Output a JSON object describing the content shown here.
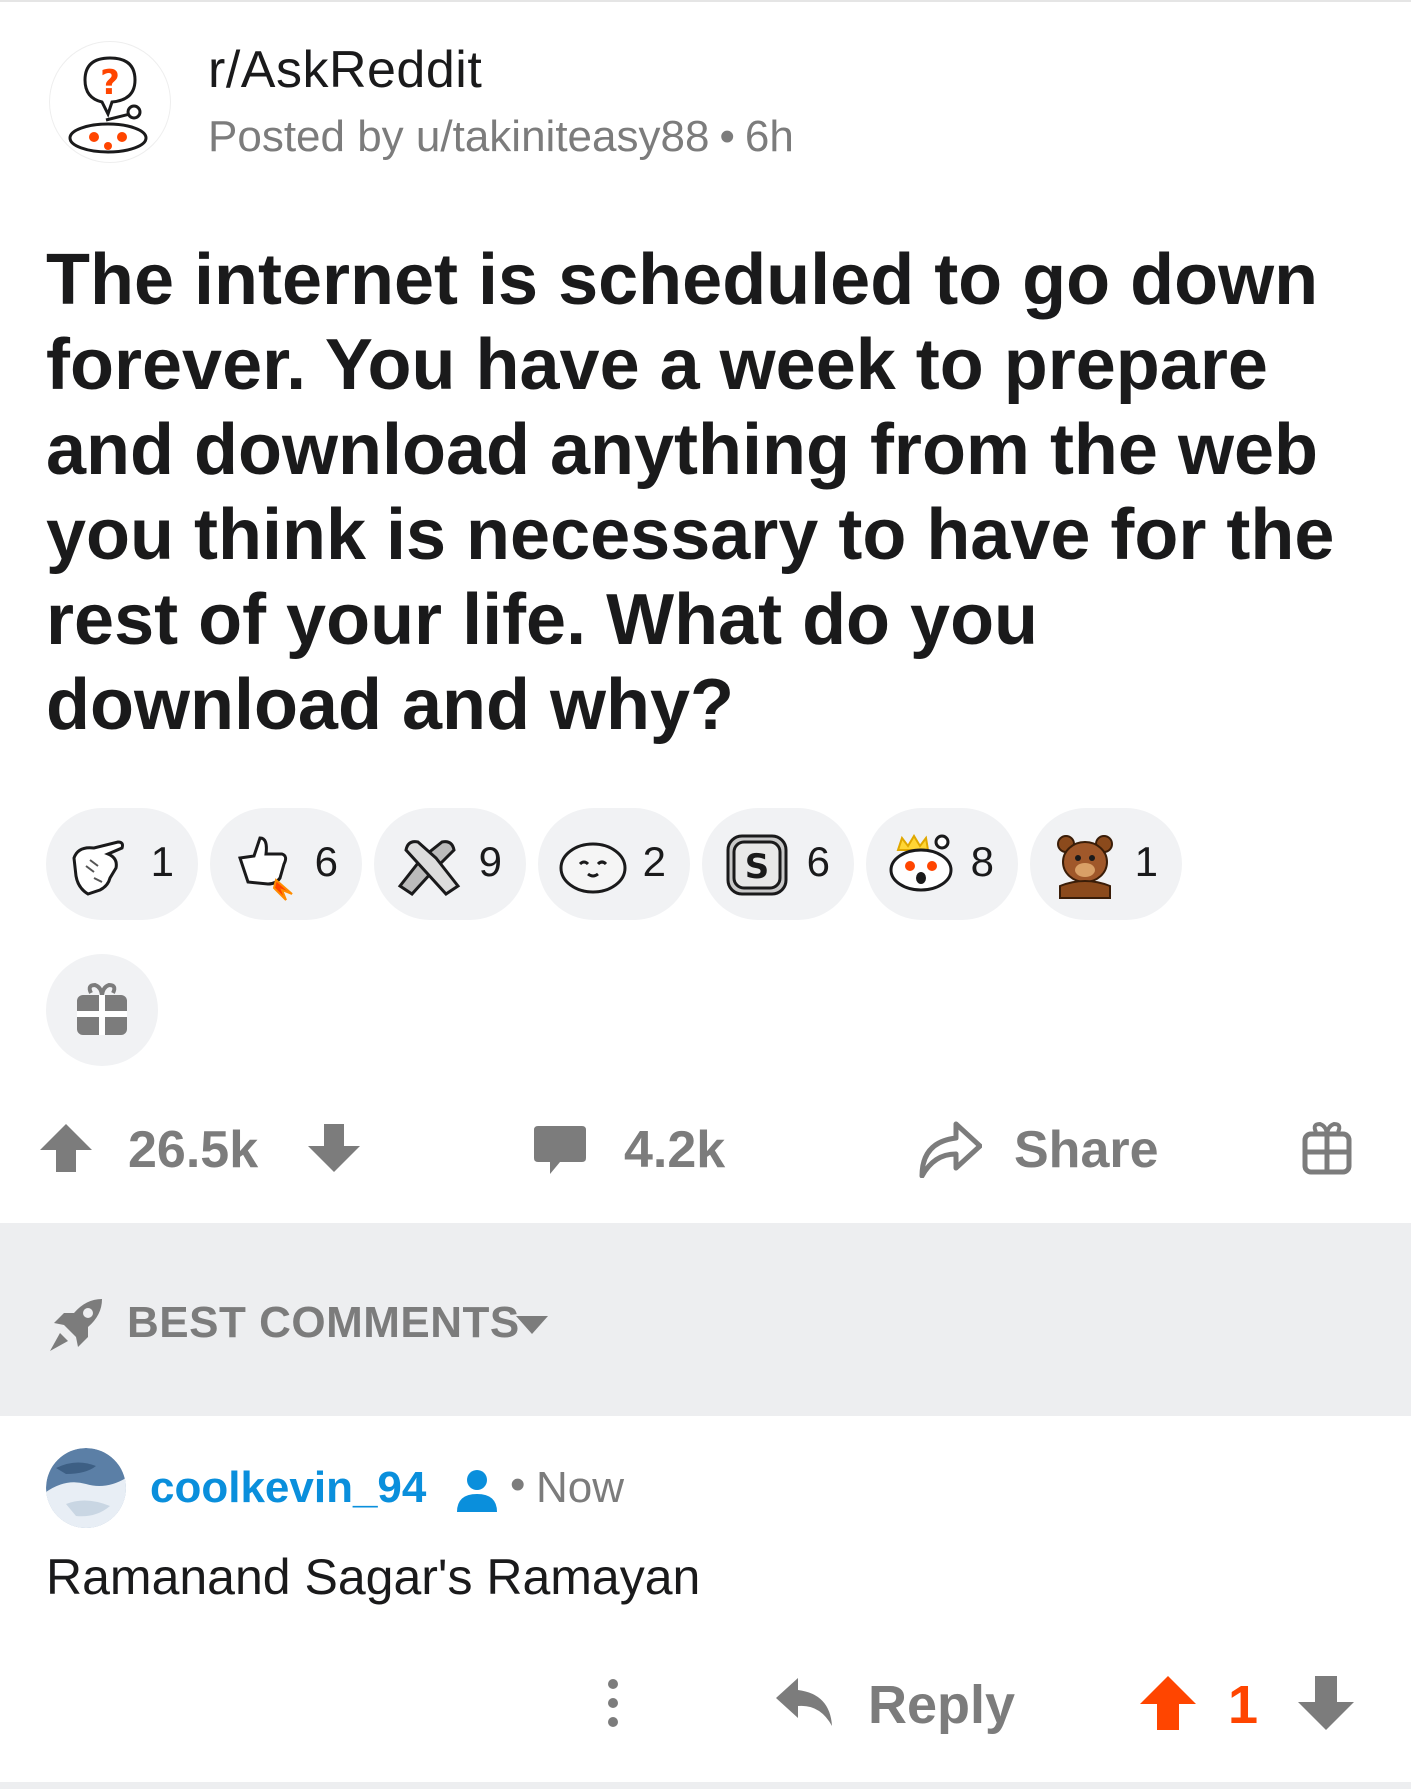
{
  "post": {
    "subreddit": "r/AskReddit",
    "posted_by": "Posted by u/takiniteasy88",
    "age": "6h",
    "title": "The internet is scheduled to go down forever. You have a week to prepare and download anything from the web you think is necessary to have for the rest of your life. What do you download and why?"
  },
  "awards": [
    {
      "icon": "pointing-hand-icon",
      "count": "1"
    },
    {
      "icon": "rocket-like-icon",
      "count": "6"
    },
    {
      "icon": "handshake-icon",
      "count": "9"
    },
    {
      "icon": "seal-icon",
      "count": "2"
    },
    {
      "icon": "silver-coin-icon",
      "count": "6"
    },
    {
      "icon": "snoo-crown-icon",
      "count": "8"
    },
    {
      "icon": "bear-icon",
      "count": "1"
    }
  ],
  "actions": {
    "score": "26.5k",
    "comments": "4.2k",
    "share": "Share"
  },
  "sort": {
    "label": "BEST COMMENTS"
  },
  "comment": {
    "username": "coolkevin_94",
    "dot": "•",
    "time": "Now",
    "body": "Ramanand Sagar's Ramayan",
    "reply": "Reply",
    "score": "1"
  },
  "colors": {
    "accent_orange": "#ff4500",
    "username_blue": "#0a8fdc",
    "meta_gray": "#7c7c7c",
    "pill_bg": "#f1f2f4",
    "band_bg": "#edeef0"
  }
}
